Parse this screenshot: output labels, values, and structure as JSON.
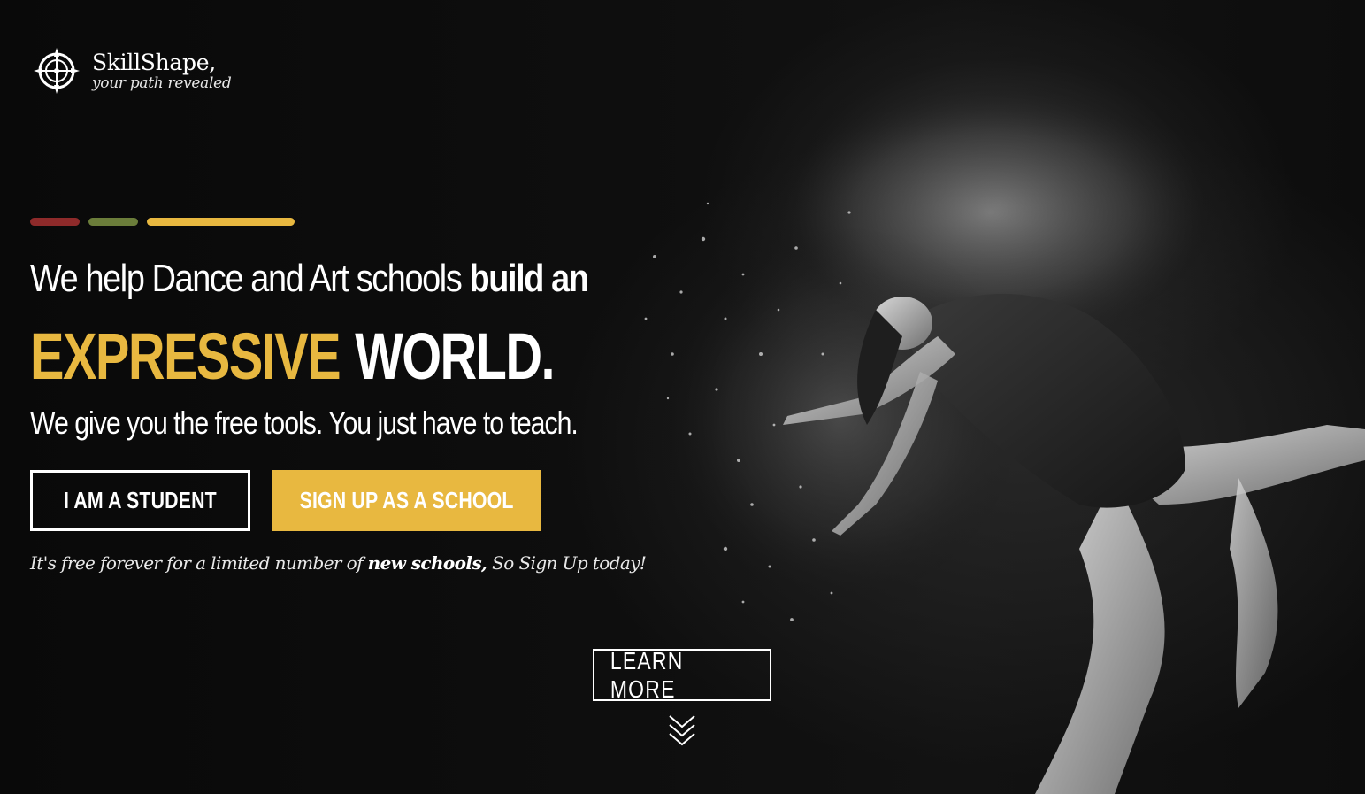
{
  "brand": {
    "name": "SkillShape,",
    "tagline": "your path revealed",
    "logo_icon": "compass-icon"
  },
  "colors": {
    "accent_red": "#8e2a2a",
    "accent_green": "#6b7d3a",
    "accent_yellow": "#e8b840",
    "background": "#0b0b0b"
  },
  "hero": {
    "headline_regular": "We help Dance and Art schools ",
    "headline_bold": "build an",
    "big_accent": "EXPRESSIVE",
    "big_white": "WORLD.",
    "subline": "We give you the free tools. You just have to teach.",
    "student_button": "I AM A STUDENT",
    "school_button": "SIGN UP AS A SCHOOL",
    "note_before": "It's free forever for a limited number of ",
    "note_bold": "new schools,",
    "note_after": " So Sign Up today!",
    "learn_more": "LEARN MORE",
    "scroll_icon": "double-chevron-down-icon"
  }
}
